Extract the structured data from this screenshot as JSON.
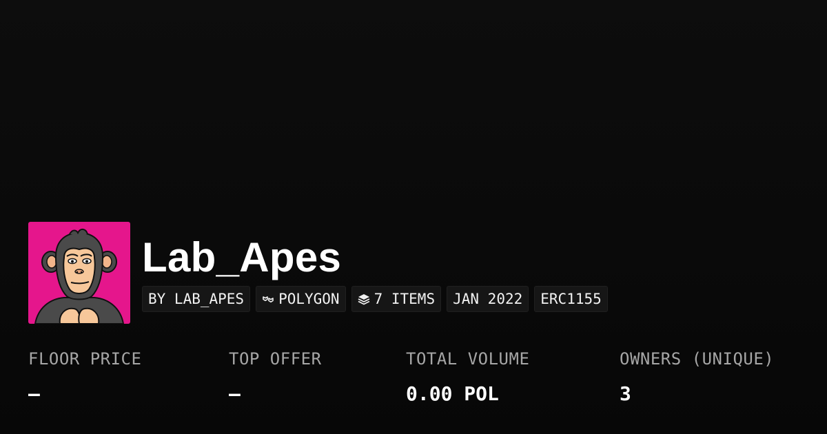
{
  "collection": {
    "name": "Lab_Apes",
    "avatar": {
      "icon": "ape-avatar",
      "background_color": "#e5168c"
    },
    "tags": {
      "creator": "BY LAB_APES",
      "chain": "POLYGON",
      "chain_icon": "polygon-icon",
      "items": "7 ITEMS",
      "items_icon": "layers-icon",
      "date": "JAN 2022",
      "standard": "ERC1155"
    }
  },
  "stats": {
    "floor_price": {
      "label": "FLOOR PRICE",
      "value": "–"
    },
    "top_offer": {
      "label": "TOP OFFER",
      "value": "–"
    },
    "total_volume": {
      "label": "TOTAL VOLUME",
      "value": "0.00 POL"
    },
    "owners": {
      "label": "OWNERS (UNIQUE)",
      "value": "3"
    }
  },
  "colors": {
    "background": "#0b0b0b",
    "text_primary": "#ffffff",
    "text_secondary": "#a6a6a6",
    "tag_background": "#161616"
  }
}
